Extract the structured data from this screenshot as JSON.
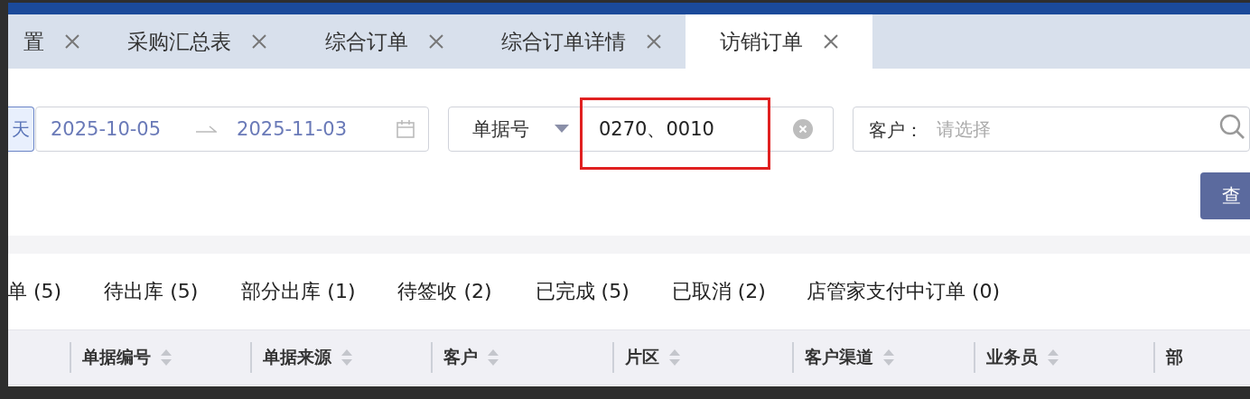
{
  "tabs": [
    {
      "label": "置",
      "selected": false
    },
    {
      "label": "采购汇总表",
      "selected": false
    },
    {
      "label": "综合订单",
      "selected": false
    },
    {
      "label": "综合订单详情",
      "selected": false
    },
    {
      "label": "访销订单",
      "selected": true
    }
  ],
  "filters": {
    "quick_date": "天",
    "date_start": "2025-10-05",
    "date_end": "2025-11-03",
    "field_select": "单据号",
    "field_value": "0270、0010",
    "customer_label": "客户：",
    "customer_placeholder": "请选择",
    "query_button": "查"
  },
  "status_tabs": [
    "单 (5)",
    "待出库 (5)",
    "部分出库 (1)",
    "待签收 (2)",
    "已完成 (5)",
    "已取消 (2)",
    "店管家支付中订单 (0)"
  ],
  "table": {
    "columns": [
      "单据编号",
      "单据来源",
      "客户",
      "片区",
      "客户渠道",
      "业务员",
      "部"
    ]
  }
}
